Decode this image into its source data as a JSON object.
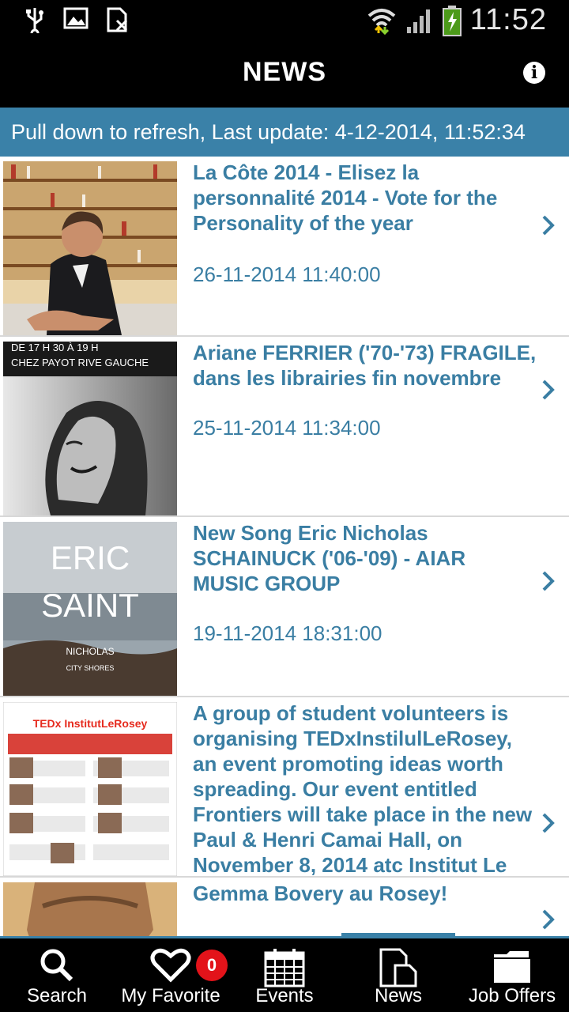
{
  "status_bar": {
    "time": "11:52"
  },
  "header": {
    "title": "NEWS"
  },
  "refresh_bar": {
    "text": "Pull down to refresh, Last update: 4-12-2014, 11:52:34"
  },
  "news": [
    {
      "title": "La Côte 2014 - Elisez la personnalité 2014 - Vote for the Personality of the year",
      "date": "26-11-2014 11:40:00"
    },
    {
      "title": "Ariane FERRIER ('70-'73) FRAGILE, dans les librairies fin novembre",
      "date": "25-11-2014 11:34:00",
      "thumb_text": "DE 17 H 30 À 19 H\nCHEZ PAYOT RIVE GAUCHE"
    },
    {
      "title": "New Song Eric Nicholas SCHAINUCK ('06-'09) - AIAR MUSIC GROUP",
      "date": "19-11-2014 18:31:00",
      "thumb_text": "ERIC SAINT",
      "thumb_subtext": "NICHOLAS",
      "thumb_caption": "CITY SHORES"
    },
    {
      "title": "A group of student volunteers is organising TEDxInstilulLeRosey, an event promoting ideas worth spreading. Our event entitled Frontiers will take place in the new Paul & Henri Camai Hall, on November 8, 2014 atc Institut Le",
      "date": "",
      "thumb_text": "TEDx InstitutLeRosey"
    },
    {
      "title": "Gemma Bovery au Rosey!",
      "date": ""
    }
  ],
  "tabs": [
    {
      "label": "Search",
      "icon": "search-icon"
    },
    {
      "label": "My Favorite",
      "icon": "heart-icon",
      "badge": "0"
    },
    {
      "label": "Events",
      "icon": "calendar-icon"
    },
    {
      "label": "News",
      "icon": "news-icon",
      "active": true
    },
    {
      "label": "Job Offers",
      "icon": "folder-icon"
    }
  ],
  "colors": {
    "accent": "#3a81a8",
    "title_text": "#3a7ea3",
    "badge": "#e3131a"
  }
}
